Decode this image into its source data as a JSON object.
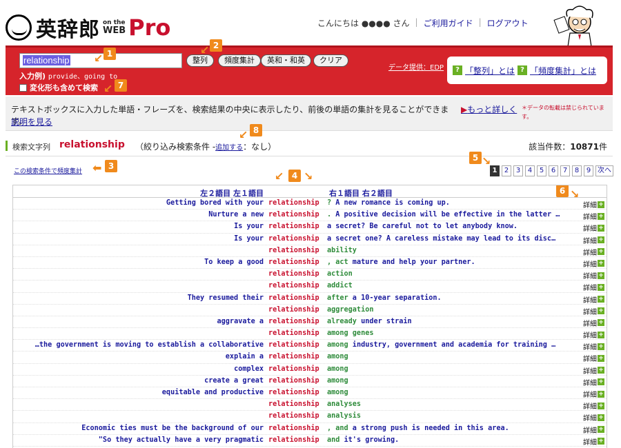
{
  "header": {
    "logo_main": "英辞郎",
    "logo_small_top": "on the",
    "logo_small_bottom": "WEB",
    "logo_pro": "Pro",
    "greeting": "こんにちは ●●●● さん",
    "nav": [
      "ご利用ガイド",
      "ログアウト"
    ]
  },
  "search": {
    "input_value": "relationship",
    "buttons": [
      "整列",
      "頻度集計",
      "英和・和英",
      "クリア"
    ],
    "example_label": "入力例)",
    "example_text": "provide、going to",
    "variant_label": "変化形も含めて検索",
    "provider": "データ提供：EDP",
    "help_links": [
      "「整列」とは",
      "「頻度集計」とは"
    ]
  },
  "description": {
    "text": "テキストボックスに入力した単語・フレーズを、検索結果の中央に表示したり、前後の単語の集計を見ることができます。",
    "more": "もっと詳しく",
    "explain": "説明を見る",
    "note": "＊データの転載は禁じられています。"
  },
  "search_info": {
    "label": "検索文字列",
    "word": "relationship",
    "filter_prefix": "（絞り込み検索条件 -",
    "filter_link": "追加する",
    "filter_suffix": "：なし）",
    "count_label": "該当件数：",
    "count": "10871",
    "count_unit": "件",
    "freq_link": "この検索条件で頻度集計"
  },
  "pager": {
    "pages": [
      "1",
      "2",
      "3",
      "4",
      "5",
      "6",
      "7",
      "8",
      "9"
    ],
    "current": "1",
    "next": "次へ"
  },
  "results": {
    "left_header": "左２語目 左１語目",
    "right_header": "右１語目 右２語目",
    "detail_label": "詳細",
    "rows": [
      {
        "left": "Getting bored with your",
        "key": "relationship",
        "right_g": "?",
        "right": " A new romance is coming up."
      },
      {
        "left": "Nurture a new",
        "key": "relationship",
        "right_g": ".",
        "right": " A positive decision will be effective in the latter …"
      },
      {
        "left": "Is your",
        "key": "relationship",
        "right_g": "",
        "right": " a secret? Be careful not to let anybody know."
      },
      {
        "left": "Is your",
        "key": "relationship",
        "right_g": "",
        "right": " a secret one? A careless mistake may lead to its disc…"
      },
      {
        "left": "",
        "key": "relationship",
        "right_g": " ability",
        "right": ""
      },
      {
        "left": "To keep a good",
        "key": "relationship",
        "right_g": ", act",
        "right": " mature and help your partner."
      },
      {
        "left": "",
        "key": "relationship",
        "right_g": " action",
        "right": ""
      },
      {
        "left": "",
        "key": "relationship",
        "right_g": " addict",
        "right": ""
      },
      {
        "left": "They resumed their",
        "key": "relationship",
        "right_g": " after",
        "right": " a 10-year separation."
      },
      {
        "left": "",
        "key": "relationship",
        "right_g": " aggregation",
        "right": ""
      },
      {
        "left": "aggravate a",
        "key": "relationship",
        "right_g": " already",
        "right": " under strain"
      },
      {
        "left": "",
        "key": "relationship",
        "right_g": " among genes",
        "right": ""
      },
      {
        "left": "…the government is moving to establish a collaborative",
        "key": "relationship",
        "right_g": " among",
        "right": " industry, government and academia for training …"
      },
      {
        "left": "explain a",
        "key": "relationship",
        "right_g": " among",
        "right": ""
      },
      {
        "left": "complex",
        "key": "relationship",
        "right_g": " among",
        "right": ""
      },
      {
        "left": "create a great",
        "key": "relationship",
        "right_g": " among",
        "right": ""
      },
      {
        "left": "equitable and productive",
        "key": "relationship",
        "right_g": " among",
        "right": ""
      },
      {
        "left": "",
        "key": "relationship",
        "right_g": " analyses",
        "right": ""
      },
      {
        "left": "",
        "key": "relationship",
        "right_g": " analysis",
        "right": ""
      },
      {
        "left": "Economic ties must be the background of our",
        "key": "relationship",
        "right_g": ", and",
        "right": " a strong push is needed in this area."
      },
      {
        "left": "\"So they actually have a very pragmatic",
        "key": "relationship",
        "right_g": " and",
        "right": " it's growing."
      }
    ]
  },
  "callouts": [
    "1",
    "2",
    "3",
    "4",
    "5",
    "6",
    "7",
    "8"
  ],
  "colors": {
    "panel_red": "#d6242b",
    "keyword_red": "#c8102e",
    "accent_green": "#6ab023",
    "callout_orange": "#f08a1c"
  }
}
